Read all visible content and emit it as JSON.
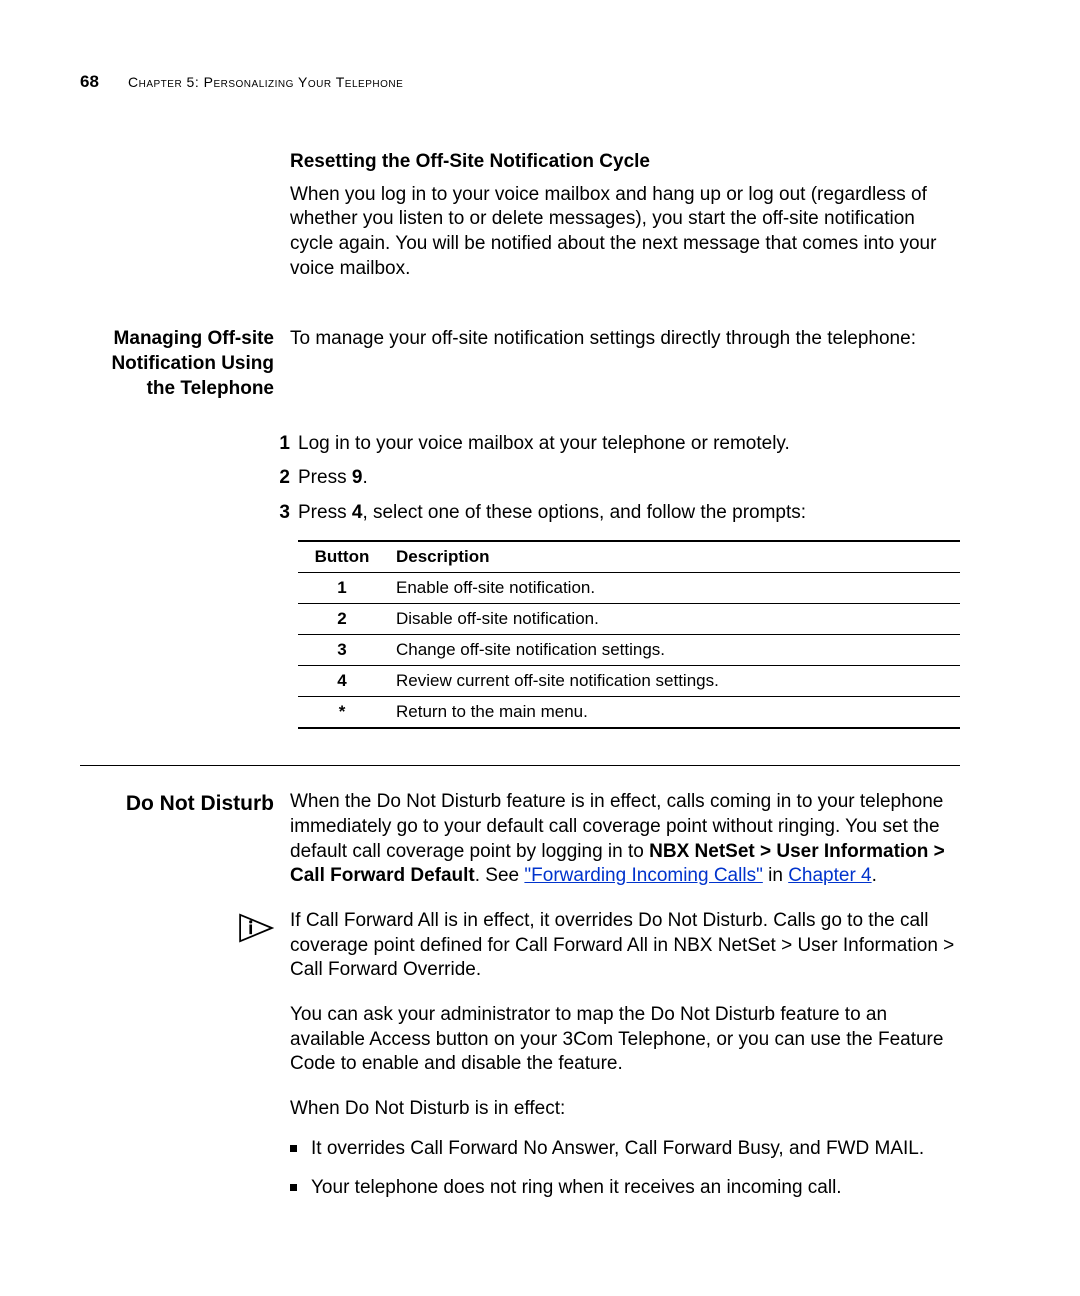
{
  "header": {
    "page_number": "68",
    "chapter_label": "Chapter 5: Personalizing Your Telephone"
  },
  "section_reset": {
    "heading": "Resetting the Off-Site Notification Cycle",
    "body": "When you log in to your voice mailbox and hang up or log out (regardless of whether you listen to or delete messages), you start the off-site notification cycle again. You will be notified about the next message that comes into your voice mailbox."
  },
  "section_manage": {
    "side_heading": "Managing Off-site Notification Using the Telephone",
    "intro": "To manage your off-site notification settings directly through the telephone:",
    "steps": [
      {
        "n": "1",
        "text_a": "Log in to your voice mailbox at your telephone or remotely."
      },
      {
        "n": "2",
        "text_a": "Press ",
        "bold": "9",
        "text_b": "."
      },
      {
        "n": "3",
        "text_a": "Press ",
        "bold": "4",
        "text_b": ", select one of these options, and follow the prompts:"
      }
    ],
    "table": {
      "col_button": "Button",
      "col_desc": "Description",
      "rows": [
        {
          "btn": "1",
          "desc": "Enable off-site notification."
        },
        {
          "btn": "2",
          "desc": "Disable off-site notification."
        },
        {
          "btn": "3",
          "desc": "Change off-site notification settings."
        },
        {
          "btn": "4",
          "desc": "Review current off-site notification settings."
        },
        {
          "btn": "*",
          "desc": "Return to the main menu."
        }
      ]
    }
  },
  "section_dnd": {
    "side_heading": "Do Not Disturb",
    "p1_a": "When the Do Not Disturb feature is in effect, calls coming in to your telephone immediately go to your default call coverage point without ringing. You set the default call coverage point by logging in to ",
    "p1_bold": "NBX NetSet > User Information > Call Forward Default",
    "p1_b": ". See ",
    "link1": "\"Forwarding Incoming Calls\"",
    "p1_c": " in ",
    "link2": "Chapter 4",
    "p1_d": ".",
    "note_a": "If Call Forward All is in effect, it overrides Do Not Disturb. Calls go to the call coverage point defined for Call Forward All in ",
    "note_b": "NBX NetSet > User Information > Call Forward Override",
    "note_c": ".",
    "p2": "You can ask your administrator to map the Do Not Disturb feature to an available Access button on your 3Com Telephone, or you can use the Feature Code to enable and disable the feature.",
    "p3": "When Do Not Disturb is in effect:",
    "bullets": [
      "It overrides Call Forward No Answer, Call Forward Busy, and FWD MAIL.",
      "Your telephone does not ring when it receives an incoming call."
    ]
  }
}
